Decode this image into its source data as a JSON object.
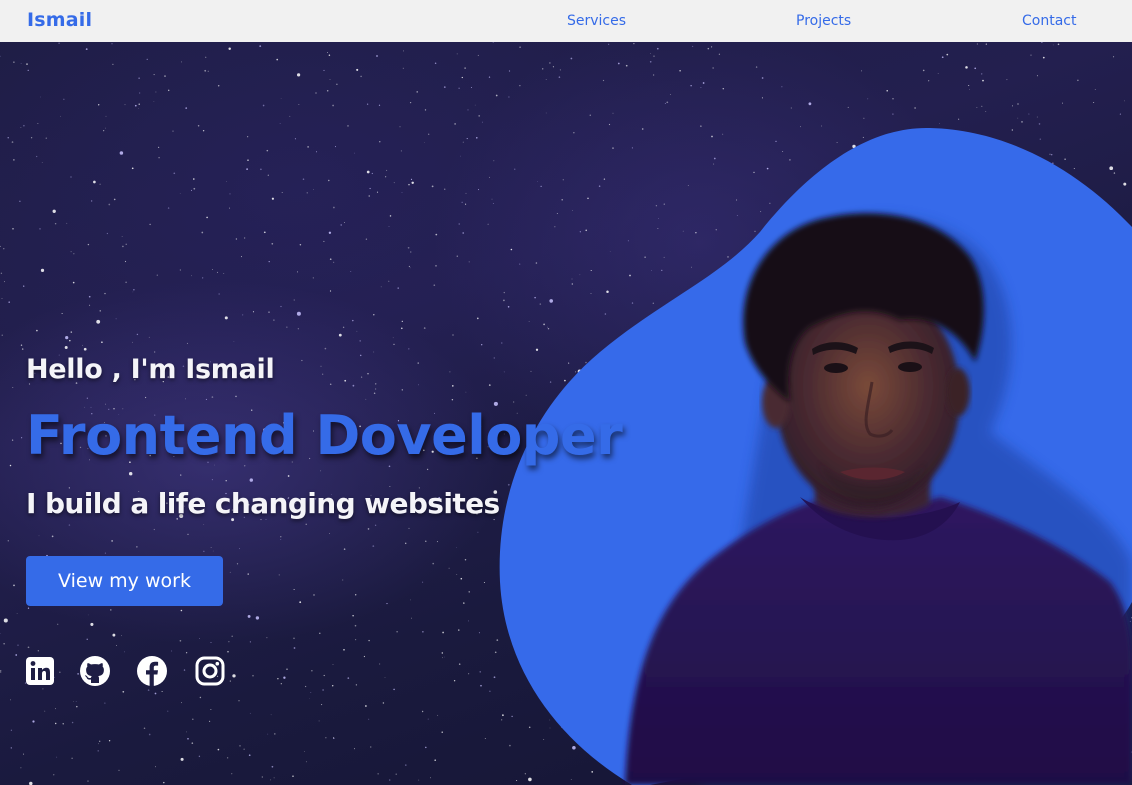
{
  "nav": {
    "brand": "Ismail",
    "links": [
      "Services",
      "Projects",
      "Contact"
    ]
  },
  "hero": {
    "greeting": "Hello , I'm Ismail",
    "role": "Frontend Doveloper",
    "tagline": "I build a life changing websites",
    "cta_label": "View my work",
    "portrait_alt": "Ismail"
  },
  "socials": [
    {
      "name": "linkedin",
      "icon": "linkedin-icon"
    },
    {
      "name": "github",
      "icon": "github-icon"
    },
    {
      "name": "facebook",
      "icon": "facebook-icon"
    },
    {
      "name": "instagram",
      "icon": "instagram-icon"
    }
  ],
  "colors": {
    "accent": "#356be8",
    "nav_bg": "#f1f1f1",
    "blob": "#366aea",
    "sky": "#1e1d44",
    "shirt": "#2a1457",
    "white": "#f4f4f8"
  }
}
